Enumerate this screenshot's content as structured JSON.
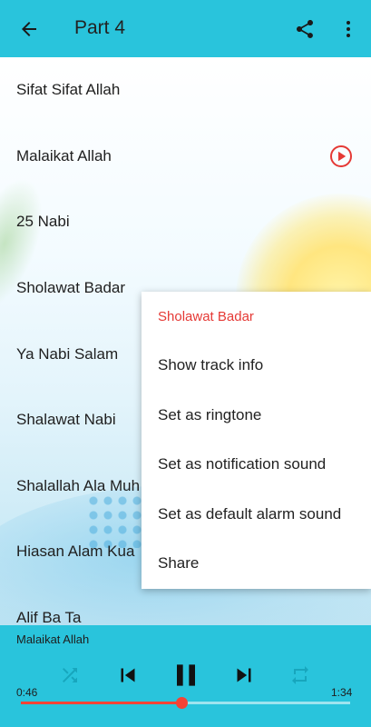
{
  "appbar": {
    "title": "Part 4",
    "back_icon": "arrow-back-icon",
    "share_icon": "share-icon",
    "more_icon": "more-vert-icon"
  },
  "tracks": [
    {
      "name": "Sifat Sifat Allah"
    },
    {
      "name": "Malaikat Allah"
    },
    {
      "name": "25 Nabi"
    },
    {
      "name": "Sholawat Badar"
    },
    {
      "name": "Ya Nabi Salam"
    },
    {
      "name": "Shalawat Nabi"
    },
    {
      "name": "Shalallah Ala Muh"
    },
    {
      "name": "Hiasan Alam Kua"
    },
    {
      "name": "Alif Ba Ta"
    }
  ],
  "playing_index": 1,
  "context_menu": {
    "header": "Sholawat Badar",
    "items": [
      "Show track info",
      "Set as ringtone",
      "Set as notification sound",
      "Set as default alarm sound",
      "Share"
    ]
  },
  "player": {
    "now_playing": "Malaikat Allah",
    "elapsed": "0:46",
    "duration": "1:34",
    "progress_fraction": 0.49,
    "icons": [
      "shuffle-icon",
      "skip-previous-icon",
      "pause-icon",
      "skip-next-icon",
      "repeat-icon"
    ]
  },
  "colors": {
    "primary": "#29c4dc",
    "accent": "#f44336",
    "menu_header": "#e53935"
  }
}
